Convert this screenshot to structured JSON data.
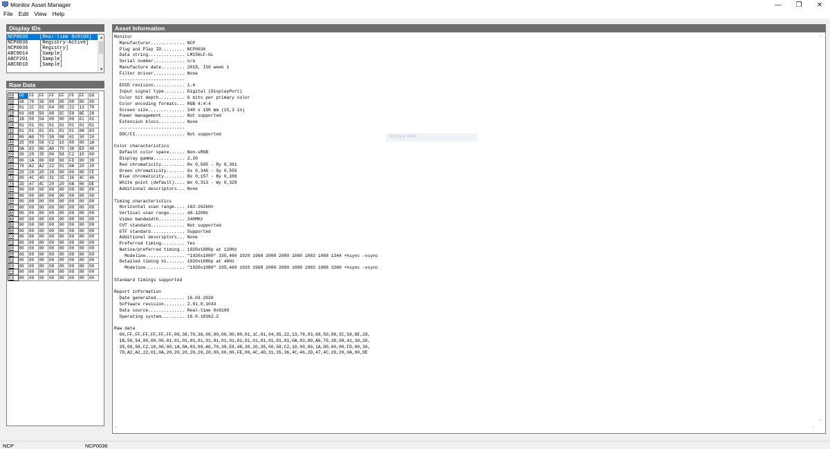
{
  "window": {
    "title": "Monitor Asset Manager"
  },
  "menu": [
    "File",
    "Edit",
    "View",
    "Help"
  ],
  "panels": {
    "display_ids": "Display IDs",
    "raw_data": "Raw Data",
    "asset_info": "Asset Information"
  },
  "display_ids": [
    {
      "id": "NCP0036",
      "desc": "[Real-time 0x9100]",
      "selected": true
    },
    {
      "id": "NCP0036",
      "desc": "[Registry-Active]",
      "selected": false
    },
    {
      "id": "NCP0036",
      "desc": "[Registry]",
      "selected": false
    },
    {
      "id": "ABC8014",
      "desc": "[Sample]",
      "selected": false
    },
    {
      "id": "ABCF201",
      "desc": "[Sample]",
      "selected": false
    },
    {
      "id": "ABC0D1D",
      "desc": "[Sample]",
      "selected": false
    }
  ],
  "raw_rows": [
    {
      "addr": "00",
      "bytes": [
        "00",
        "FF",
        "FF",
        "FF",
        "FF",
        "FF",
        "FF",
        "00"
      ]
    },
    {
      "addr": "08",
      "bytes": [
        "38",
        "70",
        "36",
        "00",
        "00",
        "00",
        "00",
        "00"
      ]
    },
    {
      "addr": "10",
      "bytes": [
        "01",
        "1C",
        "01",
        "04",
        "95",
        "22",
        "13",
        "78"
      ]
    },
    {
      "addr": "18",
      "bytes": [
        "03",
        "68",
        "50",
        "98",
        "5C",
        "58",
        "8E",
        "28"
      ]
    },
    {
      "addr": "20",
      "bytes": [
        "1B",
        "50",
        "54",
        "00",
        "00",
        "00",
        "01",
        "01"
      ]
    },
    {
      "addr": "28",
      "bytes": [
        "01",
        "01",
        "01",
        "01",
        "01",
        "01",
        "01",
        "01"
      ]
    },
    {
      "addr": "30",
      "bytes": [
        "01",
        "01",
        "01",
        "01",
        "01",
        "01",
        "0A",
        "83"
      ]
    },
    {
      "addr": "38",
      "bytes": [
        "80",
        "A0",
        "70",
        "38",
        "08",
        "41",
        "30",
        "20"
      ]
    },
    {
      "addr": "40",
      "bytes": [
        "35",
        "00",
        "58",
        "C2",
        "10",
        "00",
        "00",
        "1A"
      ]
    },
    {
      "addr": "48",
      "bytes": [
        "0A",
        "83",
        "80",
        "A0",
        "70",
        "38",
        "E8",
        "48"
      ]
    },
    {
      "addr": "50",
      "bytes": [
        "30",
        "20",
        "35",
        "00",
        "58",
        "C2",
        "10",
        "00"
      ]
    },
    {
      "addr": "58",
      "bytes": [
        "00",
        "1A",
        "00",
        "00",
        "00",
        "FD",
        "00",
        "30"
      ]
    },
    {
      "addr": "60",
      "bytes": [
        "78",
        "A2",
        "A2",
        "22",
        "01",
        "0A",
        "20",
        "20"
      ]
    },
    {
      "addr": "68",
      "bytes": [
        "20",
        "20",
        "20",
        "20",
        "00",
        "00",
        "00",
        "FE"
      ]
    },
    {
      "addr": "70",
      "bytes": [
        "00",
        "4C",
        "4D",
        "31",
        "35",
        "36",
        "4C",
        "46"
      ]
    },
    {
      "addr": "78",
      "bytes": [
        "2D",
        "47",
        "4C",
        "20",
        "20",
        "0A",
        "00",
        "DE"
      ]
    },
    {
      "addr": "80",
      "bytes": [
        "00",
        "00",
        "00",
        "00",
        "00",
        "00",
        "00",
        "00"
      ]
    },
    {
      "addr": "88",
      "bytes": [
        "00",
        "00",
        "00",
        "00",
        "00",
        "00",
        "00",
        "00"
      ]
    },
    {
      "addr": "90",
      "bytes": [
        "00",
        "00",
        "00",
        "00",
        "00",
        "00",
        "00",
        "00"
      ]
    },
    {
      "addr": "98",
      "bytes": [
        "00",
        "00",
        "00",
        "00",
        "00",
        "00",
        "00",
        "00"
      ]
    },
    {
      "addr": "A0",
      "bytes": [
        "00",
        "00",
        "00",
        "00",
        "00",
        "00",
        "00",
        "00"
      ]
    },
    {
      "addr": "A8",
      "bytes": [
        "00",
        "00",
        "00",
        "00",
        "00",
        "00",
        "00",
        "00"
      ]
    },
    {
      "addr": "B0",
      "bytes": [
        "00",
        "00",
        "00",
        "00",
        "00",
        "00",
        "00",
        "00"
      ]
    },
    {
      "addr": "B8",
      "bytes": [
        "00",
        "00",
        "00",
        "00",
        "00",
        "00",
        "00",
        "00"
      ]
    },
    {
      "addr": "C0",
      "bytes": [
        "00",
        "00",
        "00",
        "00",
        "00",
        "00",
        "00",
        "00"
      ]
    },
    {
      "addr": "C8",
      "bytes": [
        "00",
        "00",
        "00",
        "00",
        "00",
        "00",
        "00",
        "00"
      ]
    },
    {
      "addr": "D0",
      "bytes": [
        "00",
        "00",
        "00",
        "00",
        "00",
        "00",
        "00",
        "00"
      ]
    },
    {
      "addr": "D8",
      "bytes": [
        "00",
        "00",
        "00",
        "00",
        "00",
        "00",
        "00",
        "00"
      ]
    },
    {
      "addr": "E0",
      "bytes": [
        "00",
        "00",
        "00",
        "00",
        "00",
        "00",
        "00",
        "00"
      ]
    },
    {
      "addr": "E8",
      "bytes": [
        "00",
        "00",
        "00",
        "00",
        "00",
        "00",
        "00",
        "00"
      ]
    },
    {
      "addr": "F0",
      "bytes": [
        "00",
        "00",
        "00",
        "00",
        "00",
        "00",
        "00",
        "00"
      ]
    },
    {
      "addr": "F8",
      "bytes": [
        "00",
        "00",
        "00",
        "00",
        "00",
        "00",
        "00",
        "00"
      ]
    }
  ],
  "asset_info_lines": [
    "Monitor",
    "  Manufacturer............. NCP",
    "  Plug and Play ID......... NCP0036",
    "  Data string.............. LM156LF-GL",
    "  Serial number............ n/a",
    "  Manufacture date......... 2018, ISO week 1",
    "  Filter driver............ None",
    "  -------------------------",
    "  EDID revision............ 1.4",
    "  Input signal type........ Digital (DisplayPort)",
    "  Color bit depth.......... 6 bits per primary color",
    "  Color encoding formats... RGB 4:4:4",
    "  Screen size.............. 340 x 190 mm (15,3 in)",
    "  Power management......... Not supported",
    "  Extension blocs.......... None",
    "  -------------------------",
    "  DDC/CI................... Not supported",
    "",
    "Color characteristics",
    "  Default color space...... Non-sRGB",
    "  Display gamma............ 2,20",
    "  Red chromaticity......... Rx 0,595 - Ry 0,361",
    "  Green chromaticity....... Gx 0,346 - Gy 0,555",
    "  Blue chromaticity........ Bx 0,157 - By 0,106",
    "  White point (default).... Wx 0,313 - Wy 0,329",
    "  Additional descriptors... None",
    "",
    "Timing characteristics",
    "  Horizontal scan range.... 162-162kHz",
    "  Vertical scan range...... 48-120Hz",
    "  Video bandwidth.......... 340MHz",
    "  CVT standard............. Not supported",
    "  GTF standard............. Supported",
    "  Additional descriptors... None",
    "  Preferred timing......... Yes",
    "  Native/preferred timing.. 1920x1080p at 120Hz",
    "    Modeline............... \"1920x1080\" 335,460 1920 1968 2000 2080 1080 1083 1088 1344 +hsync -vsync",
    "  Detailed timing #1....... 1920x1080p at 48Hz",
    "    Modeline............... \"1920x1080\" 335,460 1920 1968 2000 2080 1080 1083 1088 3360 +hsync -vsync",
    "",
    "Standard timings supported",
    "",
    "Report information",
    "  Date generated........... 16.03.2020",
    "  Software revision........ 2.91.0.1043",
    "  Data source.............. Real-time 0x9100",
    "  Operating system......... 10.0.18362.2",
    "",
    "Raw data",
    "  00,FF,FF,FF,FF,FF,FF,00,38,70,36,00,00,00,00,00,01,1C,01,04,95,22,13,78,03,68,50,98,5C,58,8E,28,",
    "  1B,50,54,00,00,00,01,01,01,01,01,01,01,01,01,01,01,01,01,01,01,01,0A,83,80,A0,70,38,08,41,30,20,",
    "  35,00,58,C2,10,00,00,1A,0A,83,80,A0,70,38,E8,48,30,20,35,00,58,C2,10,00,00,1A,00,00,00,FD,00,30,",
    "  78,A2,A2,22,01,0A,20,20,20,20,20,20,00,00,00,FE,00,4C,4D,31,35,36,4C,46,2D,47,4C,20,20,0A,00,DE"
  ],
  "tooltip": "Wyczyść okno",
  "status": {
    "left": "NCP",
    "right": "NCP0036"
  }
}
